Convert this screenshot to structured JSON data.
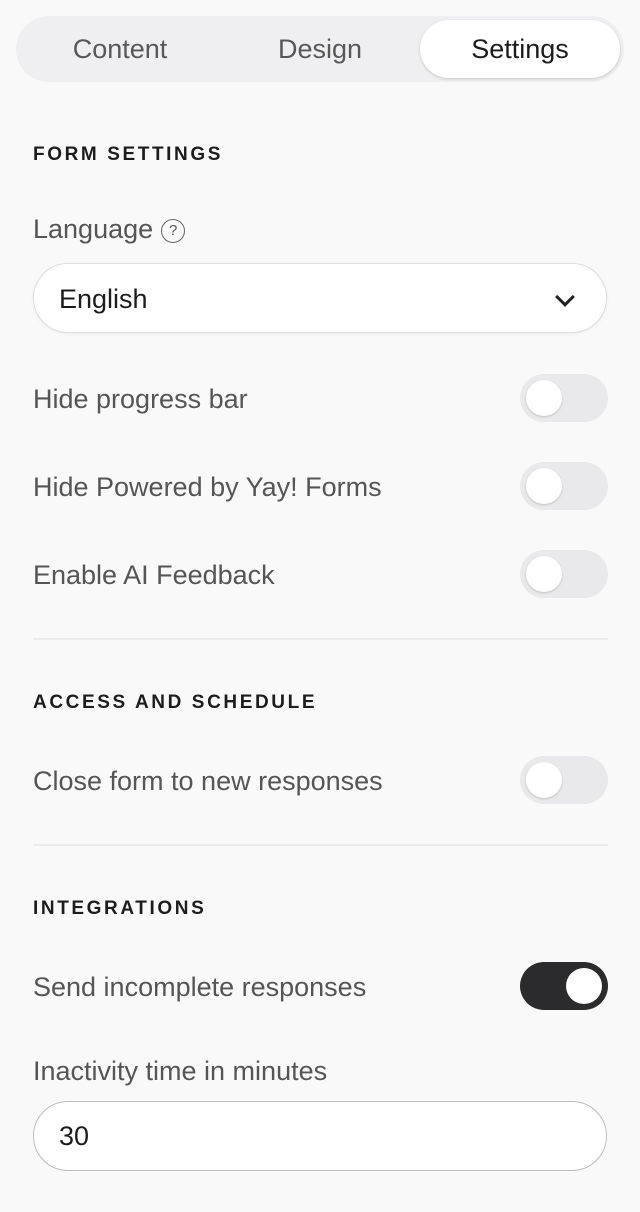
{
  "tabs": [
    {
      "label": "Content",
      "active": false
    },
    {
      "label": "Design",
      "active": false
    },
    {
      "label": "Settings",
      "active": true
    }
  ],
  "form_settings": {
    "title": "FORM SETTINGS",
    "language": {
      "label": "Language",
      "help_icon": "question-circle-icon",
      "selected": "English"
    },
    "toggles": [
      {
        "label": "Hide progress bar",
        "on": false
      },
      {
        "label": "Hide Powered by Yay! Forms",
        "on": false
      },
      {
        "label": "Enable AI Feedback",
        "on": false
      }
    ]
  },
  "access_schedule": {
    "title": "ACCESS AND SCHEDULE",
    "toggles": [
      {
        "label": "Close form to new responses",
        "on": false
      }
    ]
  },
  "integrations": {
    "title": "INTEGRATIONS",
    "toggles": [
      {
        "label": "Send incomplete responses",
        "on": true
      }
    ],
    "inactivity": {
      "label": "Inactivity time in minutes",
      "value": "30"
    }
  },
  "colors": {
    "background": "#f9f9f9",
    "toggle_off": "#e9e9eb",
    "toggle_on": "#2b2b2d",
    "active_tab": "#ffffff"
  }
}
